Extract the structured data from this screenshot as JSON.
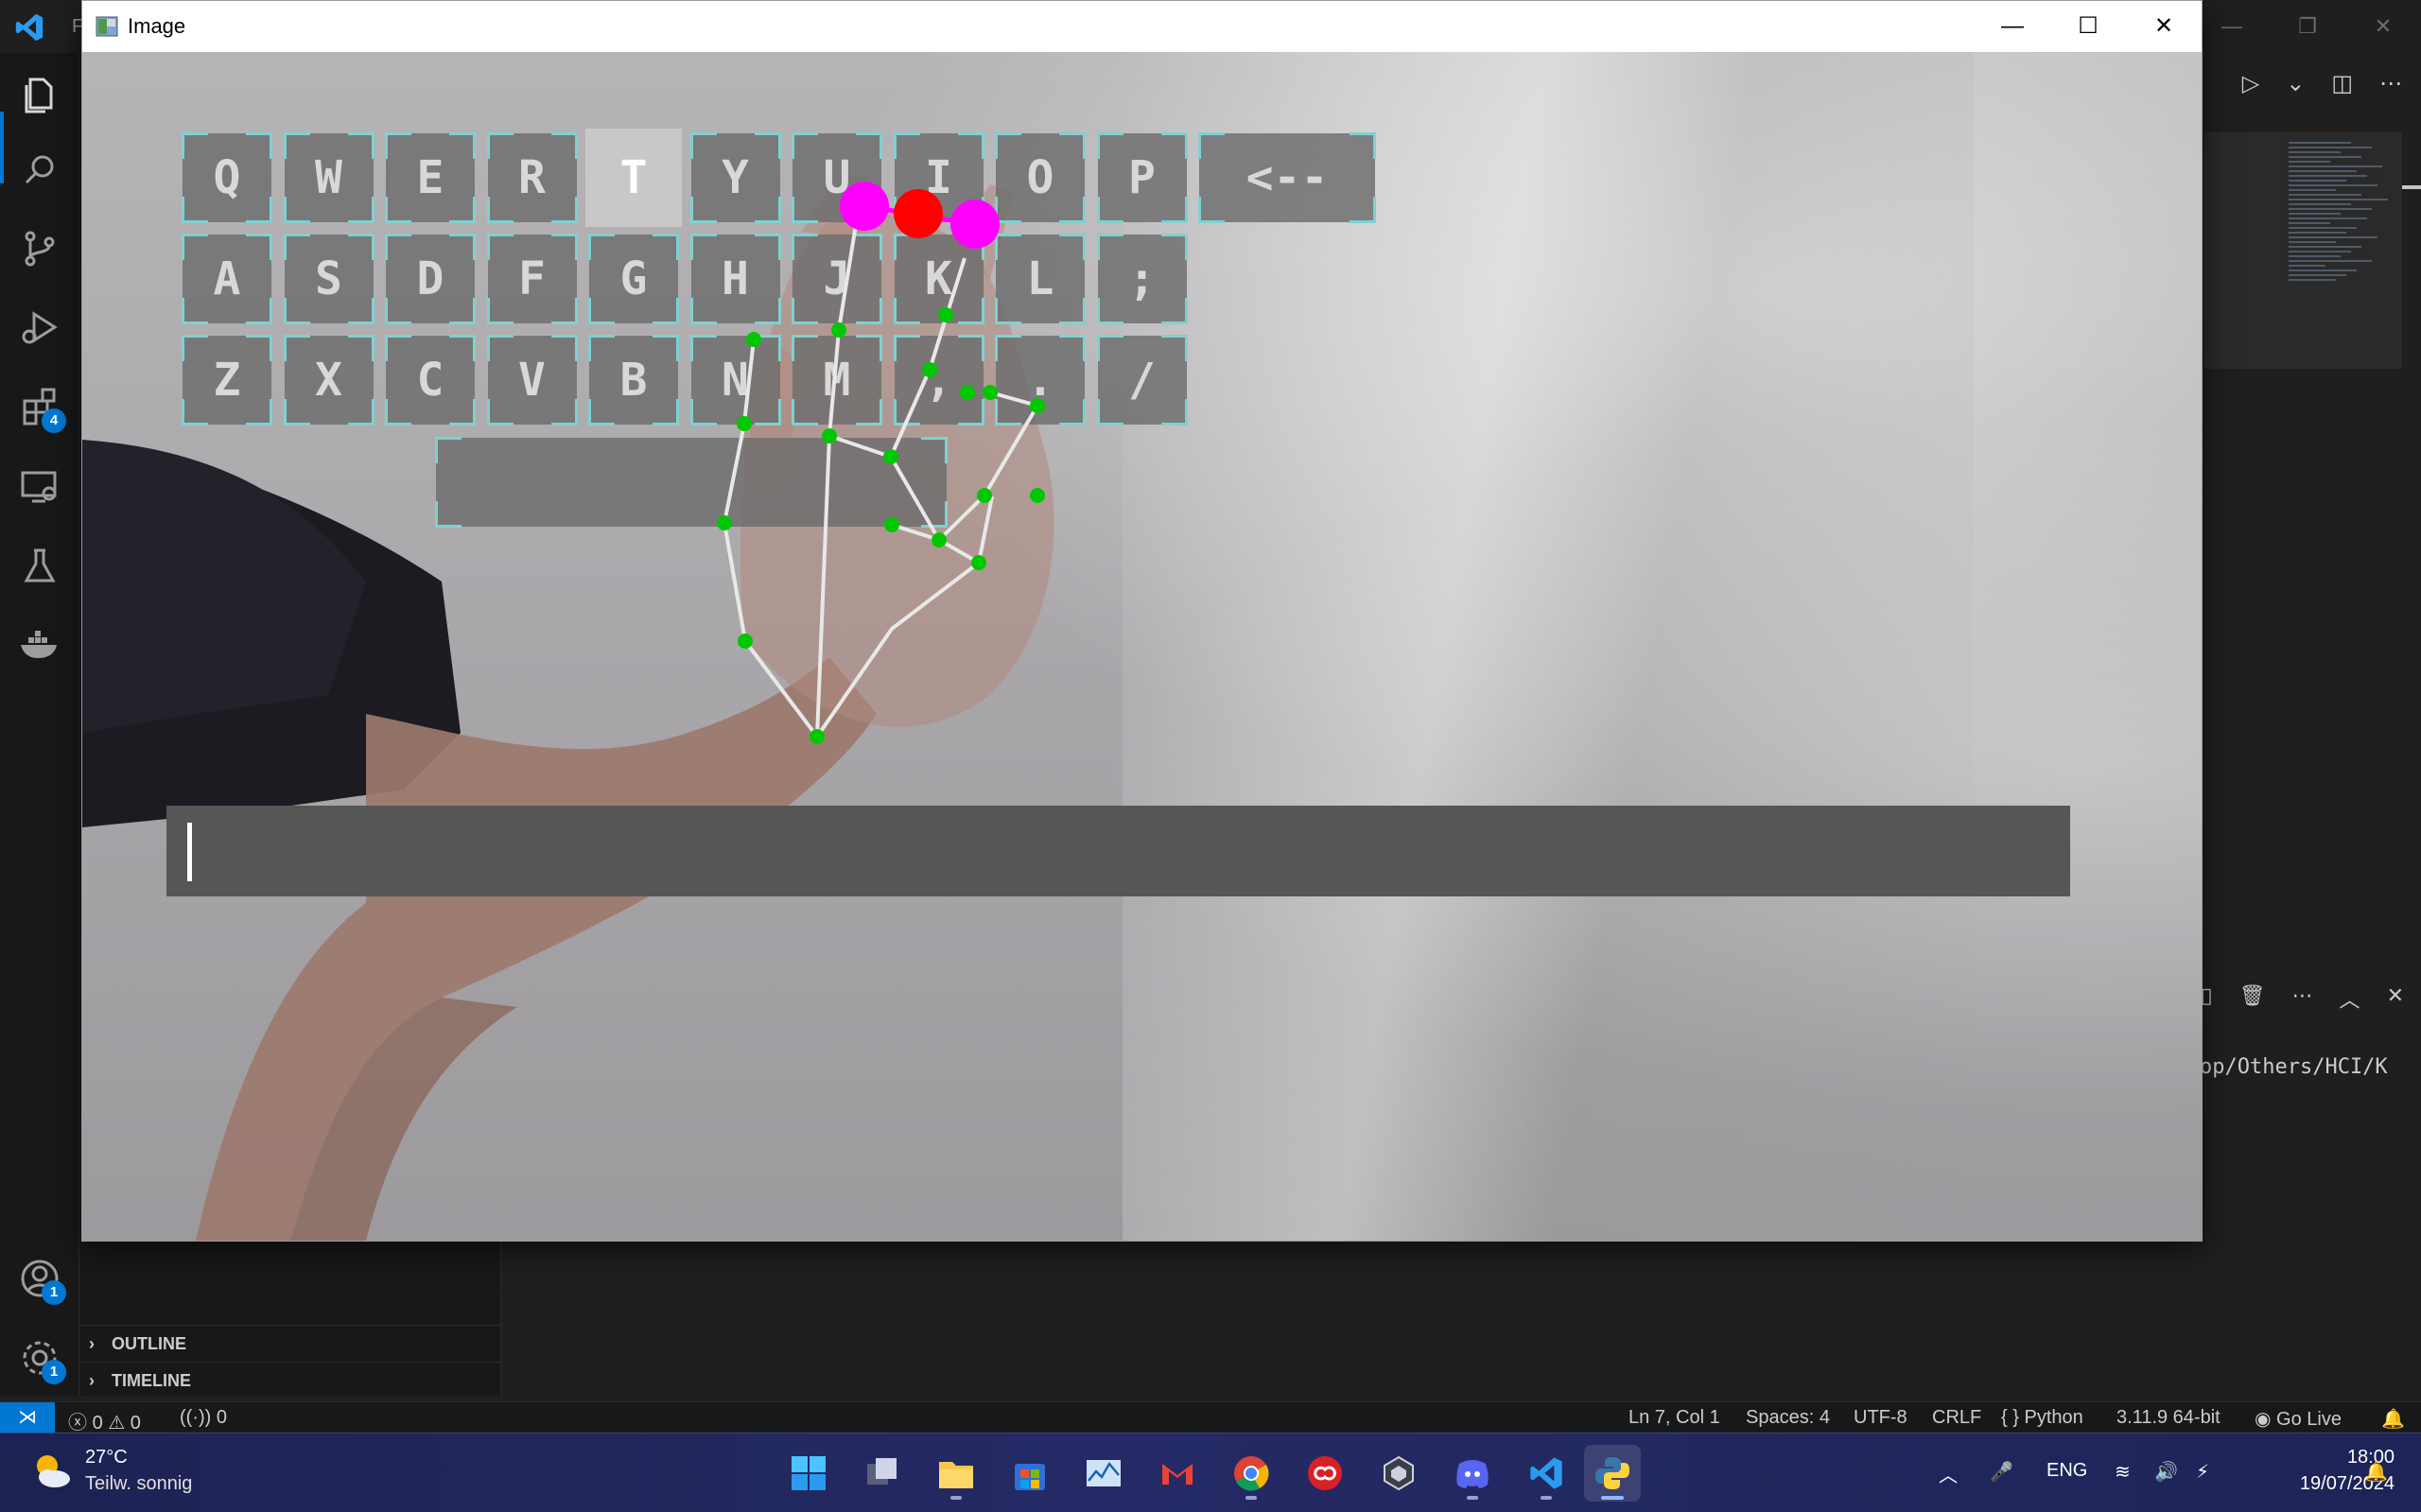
{
  "vscode": {
    "menu_initial": "F",
    "window_buttons": [
      "—",
      "❐",
      "✕"
    ],
    "activity_badges": {
      "extensions": "4",
      "accounts": "1",
      "manage": "1"
    },
    "sidebar_sections": [
      {
        "chevron": "›",
        "label": "OUTLINE"
      },
      {
        "chevron": "›",
        "label": "TIMELINE"
      }
    ],
    "editor_toolbar": [
      "▷",
      "⌄",
      "◫",
      "⋯"
    ],
    "panel_buttons": [
      "◫",
      "🗑",
      "⋯",
      "︿",
      "✕"
    ],
    "terminal_text": "op/Others/HCI/K",
    "accent": "#0078d4"
  },
  "statusbar": {
    "remote_icon": "⋊",
    "errors": "0",
    "warnings": "0",
    "ports": "0",
    "position": "Ln 7, Col 1",
    "spaces": "Spaces: 4",
    "encoding": "UTF-8",
    "eol": "CRLF",
    "language": "Python",
    "interpreter": "3.11.9 64-bit",
    "golive": "Go Live",
    "error_glyph": "ⓧ",
    "warning_glyph": "⚠",
    "ports_glyph": "((·))",
    "lang_glyph": "{ }",
    "golive_glyph": "◉",
    "bell_glyph": "🔔"
  },
  "image_window": {
    "title": "Image",
    "controls": [
      "—",
      "☐",
      "✕"
    ]
  },
  "keyboard": {
    "key_fill": "#6c6c6c",
    "corner_color": "#7fd1d1",
    "pressed_fill": "#c8c8c8",
    "rows": [
      [
        "Q",
        "W",
        "E",
        "R",
        "T",
        "Y",
        "U",
        "I",
        "O",
        "P",
        "<--"
      ],
      [
        "A",
        "S",
        "D",
        "F",
        "G",
        "H",
        "J",
        "K",
        "L",
        ";"
      ],
      [
        "Z",
        "X",
        "C",
        "V",
        "B",
        "N",
        "M",
        ",",
        ".",
        "/"
      ]
    ],
    "space_label": "",
    "pressed_key": "T",
    "typed_text": ""
  },
  "hand": {
    "landmark_color": "#00c800",
    "fingertip_color": "#ff00ff",
    "click_color": "#ff0000"
  },
  "taskbar": {
    "temperature": "27°C",
    "weather": "Teilw. sonnig",
    "apps": [
      "start",
      "task-view",
      "file-explorer",
      "ms-store",
      "resource-monitor",
      "gmail",
      "chrome",
      "creative-cloud",
      "unity",
      "discord",
      "vscode",
      "python"
    ],
    "tray": {
      "chevron": "︿",
      "mic": "🎤",
      "lang": "ENG",
      "wifi": "≋",
      "volume": "🔊",
      "battery": "⚡"
    },
    "time": "18:00",
    "date": "19/07/2024",
    "notification": "🔔"
  }
}
